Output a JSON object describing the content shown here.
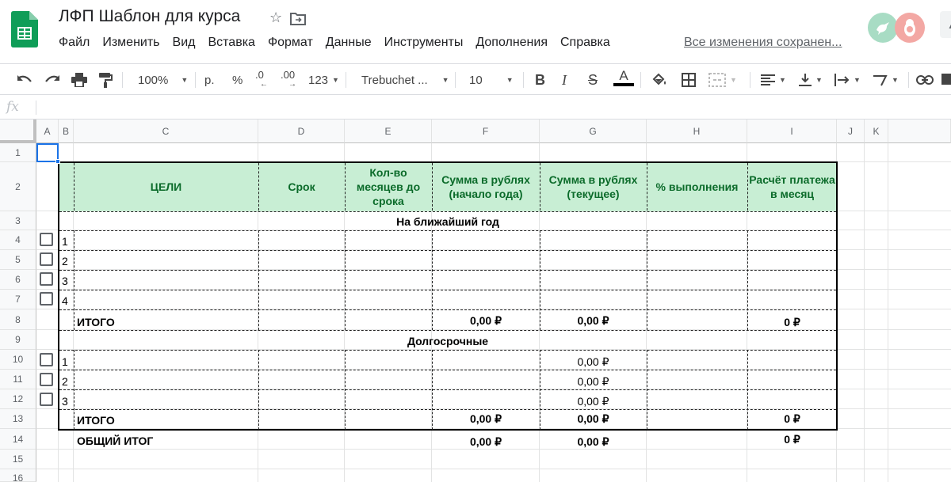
{
  "doc": {
    "title": "ЛФП Шаблон для курса",
    "saved_status": "Все изменения сохранен..."
  },
  "menu": [
    "Файл",
    "Изменить",
    "Вид",
    "Вставка",
    "Формат",
    "Данные",
    "Инструменты",
    "Дополнения",
    "Справка"
  ],
  "toolbar": {
    "zoom": "100%",
    "currency": "р.",
    "percent": "%",
    "dec_less": ".0",
    "dec_more": ".00",
    "format_num": "123",
    "font": "Trebuchet ...",
    "font_size": "10"
  },
  "formula_bar": {
    "fx_label": "fx",
    "value": ""
  },
  "columns": [
    "A",
    "B",
    "C",
    "D",
    "E",
    "F",
    "G",
    "H",
    "I",
    "J",
    "K"
  ],
  "rows": [
    "1",
    "2",
    "3",
    "4",
    "5",
    "6",
    "7",
    "8",
    "9",
    "10",
    "11",
    "12",
    "13",
    "14",
    "15",
    "16"
  ],
  "table": {
    "headers": {
      "goals": "ЦЕЛИ",
      "term": "Срок",
      "months": "Кол-во месяцев до срока",
      "sum_start": "Сумма в рублях (начало года)",
      "sum_current": "Сумма в рублях (текущее)",
      "percent": "% выполнения",
      "payment": "Расчёт платежа в месяц"
    },
    "section1": {
      "title": "На ближайший год",
      "numbers": [
        "1",
        "2",
        "3",
        "4"
      ],
      "total_label": "ИТОГО",
      "total_start": "0,00 ₽",
      "total_current": "0,00 ₽",
      "total_payment": "0 ₽"
    },
    "section2": {
      "title": "Долгосрочные",
      "numbers": [
        "1",
        "2",
        "3"
      ],
      "current_values": [
        "0,00 ₽",
        "0,00 ₽",
        "0,00 ₽"
      ],
      "total_label": "ИТОГО",
      "total_start": "0,00 ₽",
      "total_current": "0,00 ₽",
      "total_payment": "0 ₽"
    },
    "grand_total": {
      "label": "ОБЩИЙ ИТОГ",
      "start": "0,00 ₽",
      "current": "0,00 ₽",
      "payment": "0 ₽"
    }
  },
  "colors": {
    "header_fill": "#c8eed4",
    "header_text": "#0b6b2a",
    "selection": "#1a73e8"
  }
}
